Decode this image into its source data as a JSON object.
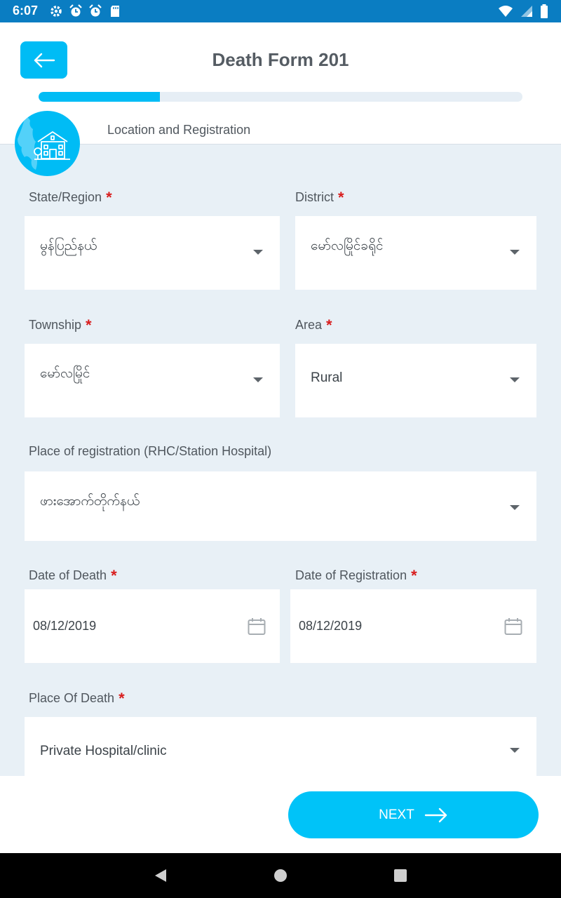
{
  "status_bar": {
    "time": "6:07",
    "left_icons": [
      "gear-icon",
      "alarm-icon",
      "alarm-icon",
      "sd-card-icon"
    ],
    "right_icons": [
      "wifi-icon",
      "signal-icon",
      "battery-icon"
    ],
    "color": "#0a7dc2"
  },
  "header": {
    "title": "Death Form 201",
    "progress": 0.25,
    "step_label": "Location and Registration",
    "accent": "#00bcf5"
  },
  "fields": {
    "state": {
      "label": "State/Region",
      "value": "မွန်ပြည်နယ်",
      "required": "*"
    },
    "district": {
      "label": "District",
      "value": "မော်လမြိုင်ခရိုင်",
      "required": "*"
    },
    "township": {
      "label": "Township",
      "value": "မော်လမြိုင်",
      "required": "*"
    },
    "area": {
      "label": "Area",
      "value": "Rural",
      "required": "*"
    },
    "place_of_registration": {
      "label": "Place of registration (RHC/Station Hospital)",
      "value": "ဖားအောက်တိုက်နယ်"
    },
    "date_of_death": {
      "label": "Date of Death",
      "value": "08/12/2019",
      "required": "*"
    },
    "date_of_registration": {
      "label": "Date of Registration",
      "value": "08/12/2019",
      "required": "*"
    },
    "place_of_death": {
      "label": "Place Of Death",
      "value": "Private Hospital/clinic",
      "required": "*"
    }
  },
  "footer": {
    "next_label": "NEXT",
    "button_color": "#00c3f8"
  },
  "nav": {
    "buttons": [
      "back-triangle-icon",
      "home-circle-icon",
      "recents-square-icon"
    ]
  }
}
